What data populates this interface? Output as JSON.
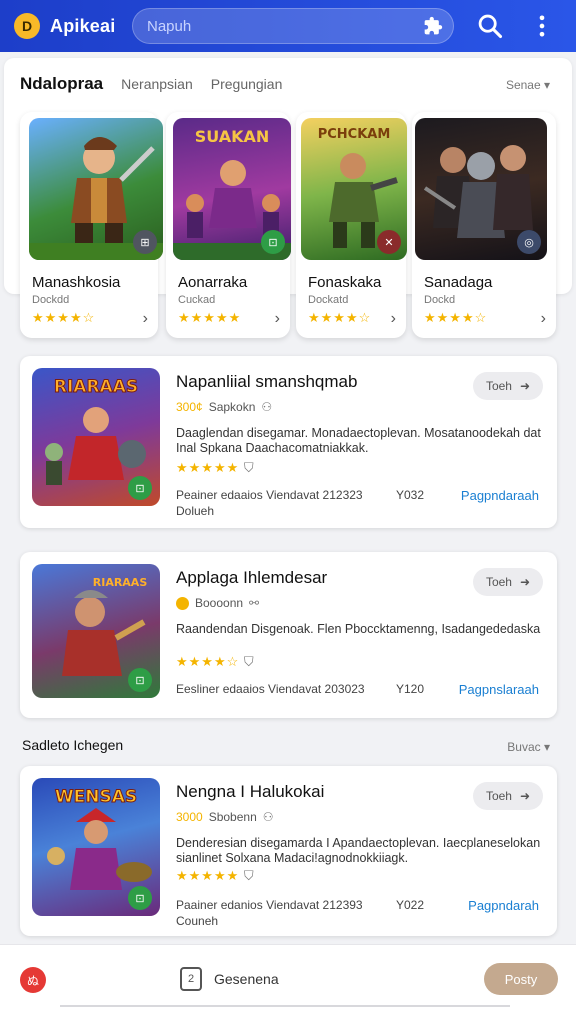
{
  "app": {
    "logo": "D",
    "title": "Apikeai"
  },
  "search": {
    "placeholder": "Napuh"
  },
  "tabs": [
    {
      "label": "Ndalopraa"
    },
    {
      "label": "Neranpsian"
    },
    {
      "label": "Pregungian"
    }
  ],
  "see_more": "Senae",
  "featured": [
    {
      "title": "Manashkosia",
      "subtitle": "Dockdd",
      "stars": "★★★★☆",
      "banner": ""
    },
    {
      "title": "Aonarraka",
      "subtitle": "Cuckad",
      "stars": "★★★★★",
      "banner": "SUAKAN"
    },
    {
      "title": "Fonaskaka",
      "subtitle": "Dockatd",
      "stars": "★★★★☆",
      "banner": "PCHCKAM"
    },
    {
      "title": "Sanadaga",
      "subtitle": "Dockd",
      "stars": "★★★★☆",
      "banner": ""
    }
  ],
  "items": [
    {
      "art_title": "RIARAAS",
      "name": "Napanliial smanshqmab",
      "meta_text": "Sapkokn",
      "meta_stars": "300¢",
      "desc": "Daaglendan disegamar. Monadaectoplevan. Mosatanoodekah dat Inal Spkana Daachacomatniakkak.",
      "stars": "★★★★★",
      "footer": "Peainer edaaios Viendavat 212323",
      "footer2": "Dolueh",
      "year": "Y032",
      "action": "Pagpndaraah",
      "pill": "Toeh"
    },
    {
      "art_title": "RIARAAS",
      "name": "Applaga Ihlemdesar",
      "meta_text": "Boooonn",
      "desc": "Raandendan Disgenoak. Flen Pboccktamenng, Isadangededaska",
      "stars": "★★★★☆",
      "footer": "Eesliner edaaios Viendavat 203023",
      "year": "Y120",
      "action": "Pagpnslaraah",
      "pill": "Toeh"
    },
    {
      "art_title": "WENSAS",
      "name": "Nengna I Halukokai",
      "meta_text": "Sbobenn",
      "meta_stars": "3000",
      "desc": "Denderesian disegamarda I Apandaectoplevan. Iaecplaneselokan sianlinet Solxana Madaci!agnodnokkiiagk.",
      "stars": "★★★★★",
      "footer": "Paainer edanios Viendavat 212393",
      "footer2": "Couneh",
      "year": "Y022",
      "action": "Pagpndarah",
      "pill": "Toeh"
    }
  ],
  "section": {
    "title": "Sadleto Ichegen",
    "more": "Buvac"
  },
  "bottom": {
    "label": "Gesenena",
    "button": "Posty",
    "logo": "ぬ"
  }
}
